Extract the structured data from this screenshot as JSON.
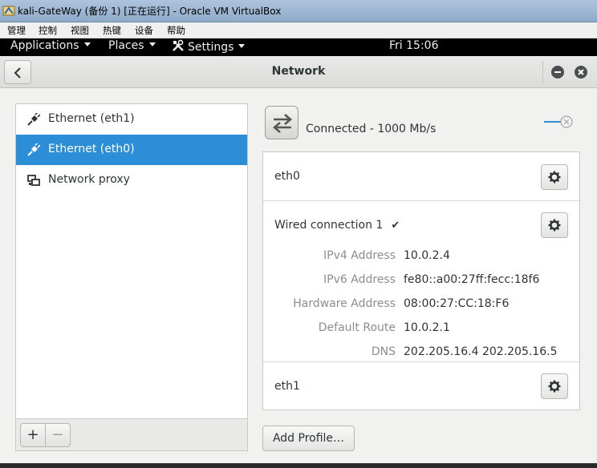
{
  "host_window": {
    "title": "kali-GateWay (备份 1) [正在运行] - Oracle VM VirtualBox",
    "menu": [
      "管理",
      "控制",
      "视图",
      "热键",
      "设备",
      "帮助"
    ]
  },
  "topbar": {
    "applications": "Applications",
    "places": "Places",
    "settings": "Settings",
    "clock": "Fri 15:06"
  },
  "header": {
    "title": "Network",
    "back_icon": "chevron-left-icon",
    "minimize_icon": "minimize-icon",
    "close_icon": "close-icon"
  },
  "devices": [
    {
      "label": "Ethernet (eth1)",
      "icon": "ethernet-plug-icon",
      "selected": false
    },
    {
      "label": "Ethernet (eth0)",
      "icon": "ethernet-plug-icon",
      "selected": true
    },
    {
      "label": "Network proxy",
      "icon": "network-proxy-icon",
      "selected": false
    }
  ],
  "list_toolbar": {
    "add": "+",
    "remove": "−"
  },
  "connection": {
    "status": "Connected - 1000 Mb/s",
    "switch_on": true
  },
  "details": {
    "iface_name": "eth0",
    "profile_name": "Wired connection 1",
    "profile_check": "✔",
    "rows": [
      {
        "key": "IPv4 Address",
        "value": "10.0.2.4"
      },
      {
        "key": "IPv6 Address",
        "value": "fe80::a00:27ff:fecc:18f6"
      },
      {
        "key": "Hardware Address",
        "value": "08:00:27:CC:18:F6"
      },
      {
        "key": "Default Route",
        "value": "10.0.2.1"
      },
      {
        "key": "DNS",
        "value": "202.205.16.4 202.205.16.5"
      }
    ],
    "other_profile": "eth1"
  },
  "add_profile": "Add Profile…",
  "colors": {
    "selection": "#2c8ed6",
    "topbar": "#000000"
  }
}
